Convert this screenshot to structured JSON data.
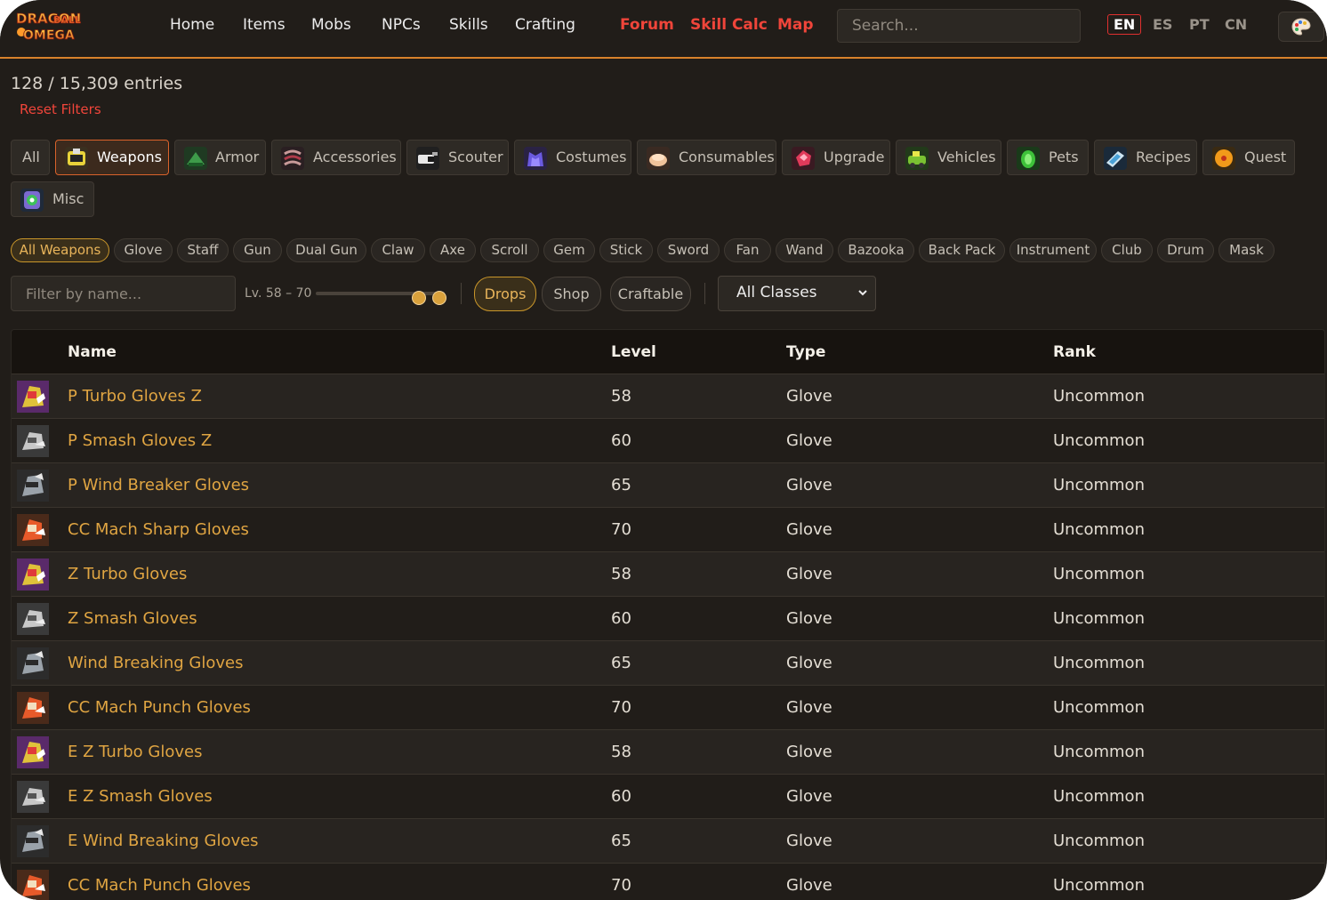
{
  "nav": {
    "logo_text": "DRAGON BALL OMEGA",
    "links": [
      "Home",
      "Items",
      "Mobs",
      "NPCs",
      "Skills",
      "Crafting"
    ],
    "highlight_links": [
      "Forum",
      "Skill Calc",
      "Map"
    ],
    "search_placeholder": "Search...",
    "languages": [
      "EN",
      "ES",
      "PT",
      "CN"
    ],
    "active_language": "EN",
    "theme_icon": "palette-icon"
  },
  "summary": {
    "entries": "128 / 15,309 entries",
    "reset": "Reset Filters"
  },
  "categories": [
    {
      "label": "All"
    },
    {
      "label": "Weapons",
      "active": true,
      "icon": "weapons-icon"
    },
    {
      "label": "Armor",
      "icon": "armor-icon"
    },
    {
      "label": "Accessories",
      "icon": "accessories-icon"
    },
    {
      "label": "Scouter",
      "icon": "scouter-icon"
    },
    {
      "label": "Costumes",
      "icon": "costumes-icon"
    },
    {
      "label": "Consumables",
      "icon": "consumables-icon"
    },
    {
      "label": "Upgrade",
      "icon": "upgrade-icon"
    },
    {
      "label": "Vehicles",
      "icon": "vehicles-icon"
    },
    {
      "label": "Pets",
      "icon": "pets-icon"
    },
    {
      "label": "Recipes",
      "icon": "recipes-icon"
    },
    {
      "label": "Quest",
      "icon": "quest-icon"
    },
    {
      "label": "Misc",
      "icon": "misc-icon"
    }
  ],
  "subtypes": [
    "All Weapons",
    "Glove",
    "Staff",
    "Gun",
    "Dual Gun",
    "Claw",
    "Axe",
    "Scroll",
    "Gem",
    "Stick",
    "Sword",
    "Fan",
    "Wand",
    "Bazooka",
    "Back Pack",
    "Instrument",
    "Club",
    "Drum",
    "Mask"
  ],
  "active_subtype": "All Weapons",
  "filters": {
    "name_placeholder": "Filter by name...",
    "level_label": "Lv. 58 – 70",
    "level_min": 58,
    "level_max": 70,
    "toggles": [
      {
        "label": "Drops",
        "active": true
      },
      {
        "label": "Shop",
        "active": false
      },
      {
        "label": "Craftable",
        "active": false
      }
    ],
    "class_select": "All Classes"
  },
  "table": {
    "columns": [
      "Name",
      "Level",
      "Type",
      "Rank"
    ],
    "rows": [
      {
        "name": "P Turbo Gloves Z",
        "level": "58",
        "type": "Glove",
        "rank": "Uncommon",
        "icon": "turbo-glove-icon"
      },
      {
        "name": "P Smash Gloves Z",
        "level": "60",
        "type": "Glove",
        "rank": "Uncommon",
        "icon": "smash-glove-icon"
      },
      {
        "name": "P Wind Breaker Gloves",
        "level": "65",
        "type": "Glove",
        "rank": "Uncommon",
        "icon": "wind-glove-icon"
      },
      {
        "name": "CC Mach Sharp Gloves",
        "level": "70",
        "type": "Glove",
        "rank": "Uncommon",
        "icon": "mach-glove-icon"
      },
      {
        "name": "Z Turbo Gloves",
        "level": "58",
        "type": "Glove",
        "rank": "Uncommon",
        "icon": "turbo-glove-icon"
      },
      {
        "name": "Z Smash Gloves",
        "level": "60",
        "type": "Glove",
        "rank": "Uncommon",
        "icon": "smash-glove-icon"
      },
      {
        "name": "Wind Breaking Gloves",
        "level": "65",
        "type": "Glove",
        "rank": "Uncommon",
        "icon": "wind-glove-icon"
      },
      {
        "name": "CC Mach Punch Gloves",
        "level": "70",
        "type": "Glove",
        "rank": "Uncommon",
        "icon": "mach-glove-icon"
      },
      {
        "name": "E Z Turbo Gloves",
        "level": "58",
        "type": "Glove",
        "rank": "Uncommon",
        "icon": "turbo-glove-icon"
      },
      {
        "name": "E Z Smash Gloves",
        "level": "60",
        "type": "Glove",
        "rank": "Uncommon",
        "icon": "smash-glove-icon"
      },
      {
        "name": "E Wind Breaking Gloves",
        "level": "65",
        "type": "Glove",
        "rank": "Uncommon",
        "icon": "wind-glove-icon"
      },
      {
        "name": "CC Mach Punch Gloves",
        "level": "70",
        "type": "Glove",
        "rank": "Uncommon",
        "icon": "mach-glove-icon"
      }
    ]
  },
  "colors": {
    "accent_orange": "#d9822b",
    "red": "#f0453a",
    "gold": "#e0a542",
    "background": "#211d19"
  }
}
